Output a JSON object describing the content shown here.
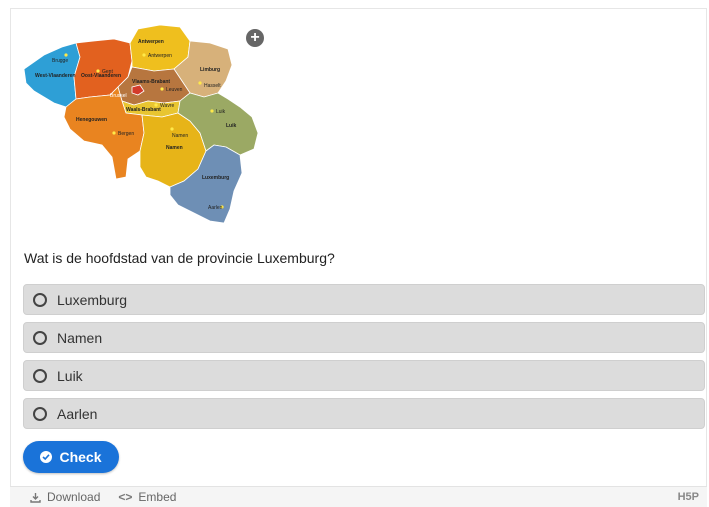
{
  "map": {
    "provinces": {
      "west_vlaanderen": "West-Vlaanderen",
      "oost_vlaanderen": "Oost-Vlaanderen",
      "antwerpen": "Antwerpen",
      "limburg": "Limburg",
      "vlaams_brabant": "Vlaams-Brabant",
      "waals_brabant": "Waals-Brabant",
      "henegouwen": "Henegouwen",
      "namen": "Namen",
      "luik": "Luik",
      "luxemburg": "Luxemburg",
      "brussel": "Brussel"
    },
    "cities": {
      "brugge": "Brugge",
      "gent": "Gent",
      "antwerpen": "Antwerpen",
      "hasselt": "Hasselt",
      "leuven": "Leuven",
      "wavre": "Wavre",
      "bergen": "Bergen",
      "namen": "Namen",
      "luik": "Luik",
      "aarlen": "Aarlen"
    },
    "colors": {
      "west_vlaanderen": "#2e9fd6",
      "oost_vlaanderen": "#e2611f",
      "antwerpen": "#efbf1e",
      "limburg": "#d7b17a",
      "vlaams_brabant": "#b7763f",
      "waals_brabant": "#e8c531",
      "henegouwen": "#e98420",
      "namen": "#e7b418",
      "luik": "#9ba964",
      "luxemburg": "#6e8fb5",
      "brussel": "#d33b2b"
    }
  },
  "question": "Wat is de hoofdstad van de provincie Luxemburg?",
  "answers": [
    "Luxemburg",
    "Namen",
    "Luik",
    "Aarlen"
  ],
  "check_label": "Check",
  "footer": {
    "download": "Download",
    "embed": "Embed",
    "logo": "H5P"
  }
}
